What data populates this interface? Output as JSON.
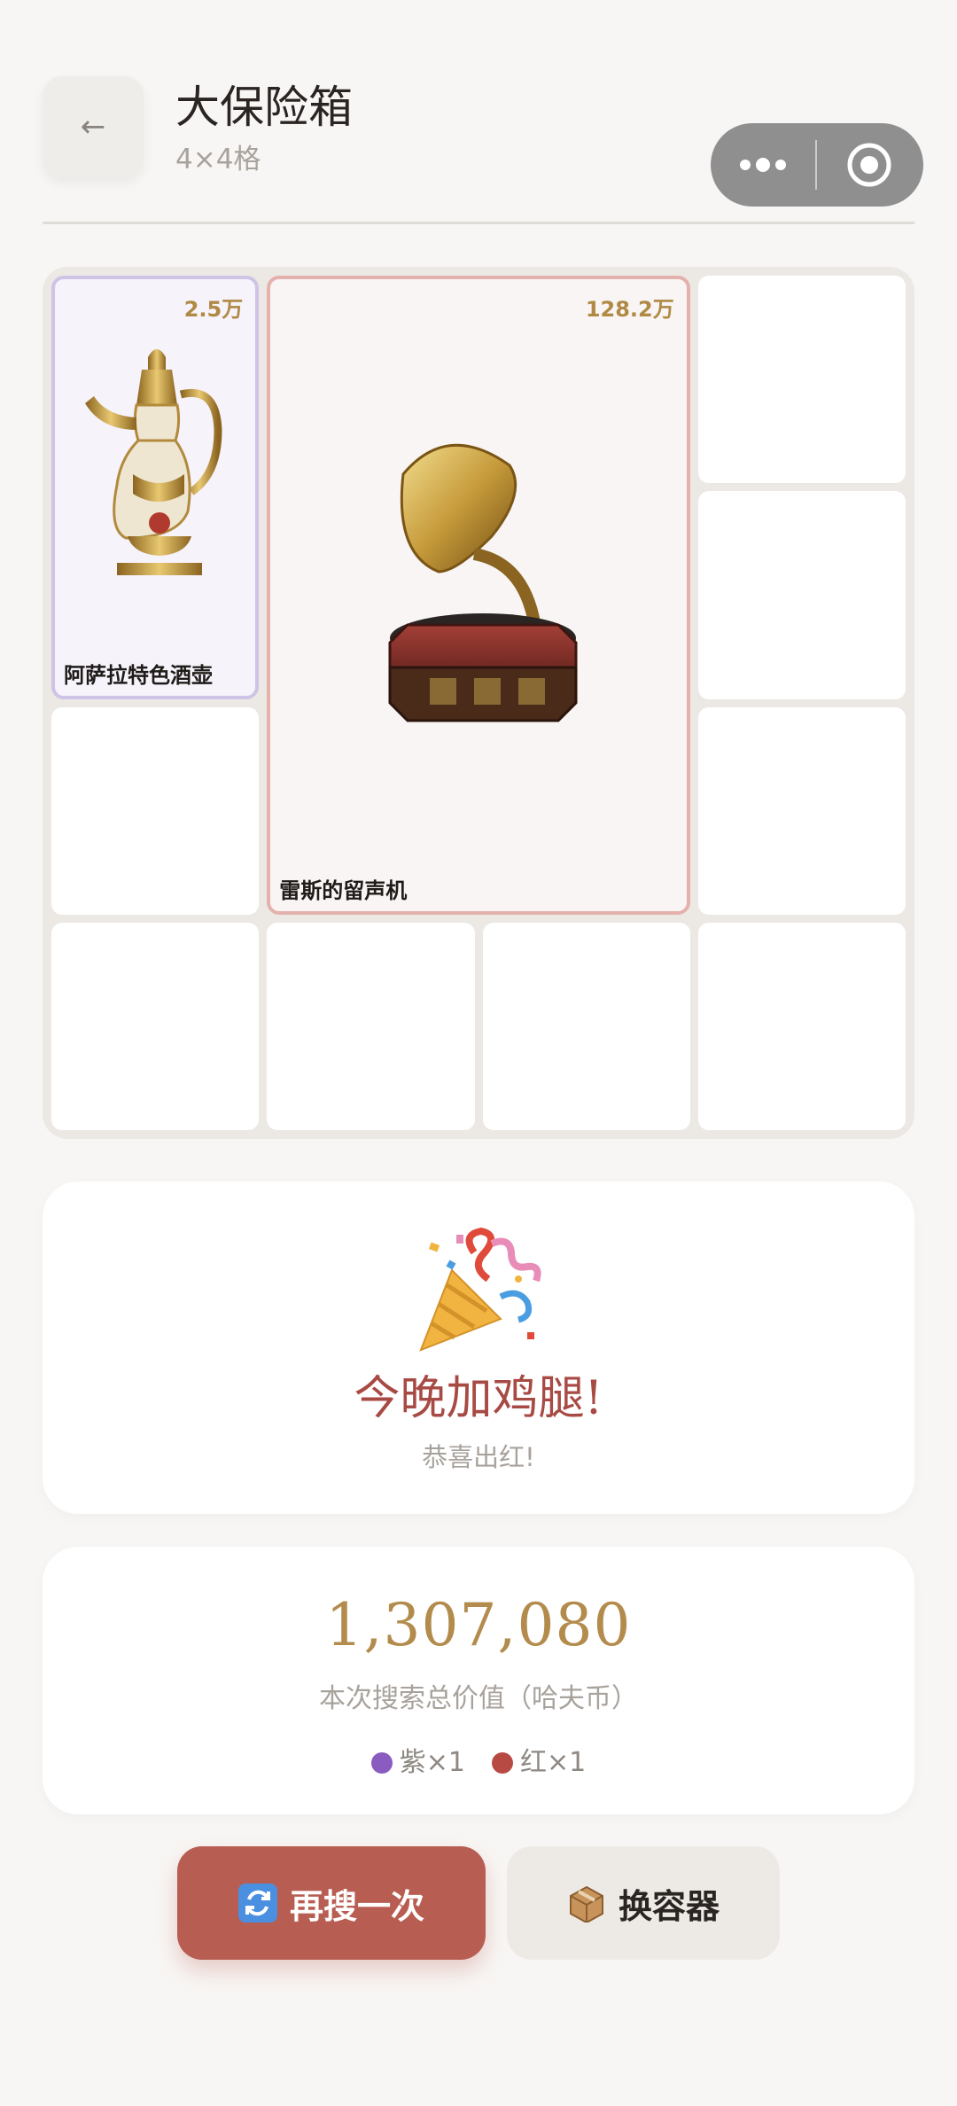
{
  "header": {
    "back_glyph": "←",
    "title": "大保险箱",
    "subtitle": "4×4格",
    "capsule_icons": [
      "more-icon",
      "target-icon"
    ]
  },
  "grid": {
    "rows": 4,
    "cols": 4,
    "items": [
      {
        "name": "阿萨拉特色酒壶",
        "price": "2.5万",
        "rarity": "purple",
        "icon": "ewer-icon"
      },
      {
        "name": "雷斯的留声机",
        "price": "128.2万",
        "rarity": "red",
        "icon": "gramophone-icon"
      }
    ]
  },
  "celebration": {
    "icon": "party-popper-icon",
    "headline": "今晚加鸡腿!",
    "message": "恭喜出红!"
  },
  "summary": {
    "total": "1,307,080",
    "label": "本次搜索总价值（哈夫币）",
    "counts": [
      {
        "label": "紫×1",
        "color": "#8a5cc0"
      },
      {
        "label": "红×1",
        "color": "#b84a44"
      }
    ]
  },
  "actions": {
    "again_label": "再搜一次",
    "switch_label": "换容器"
  },
  "colors": {
    "accent_red": "#b85d51",
    "gold": "#b38c4d",
    "purple_border": "#cfc3e6",
    "red_border": "#e4b1ad"
  }
}
